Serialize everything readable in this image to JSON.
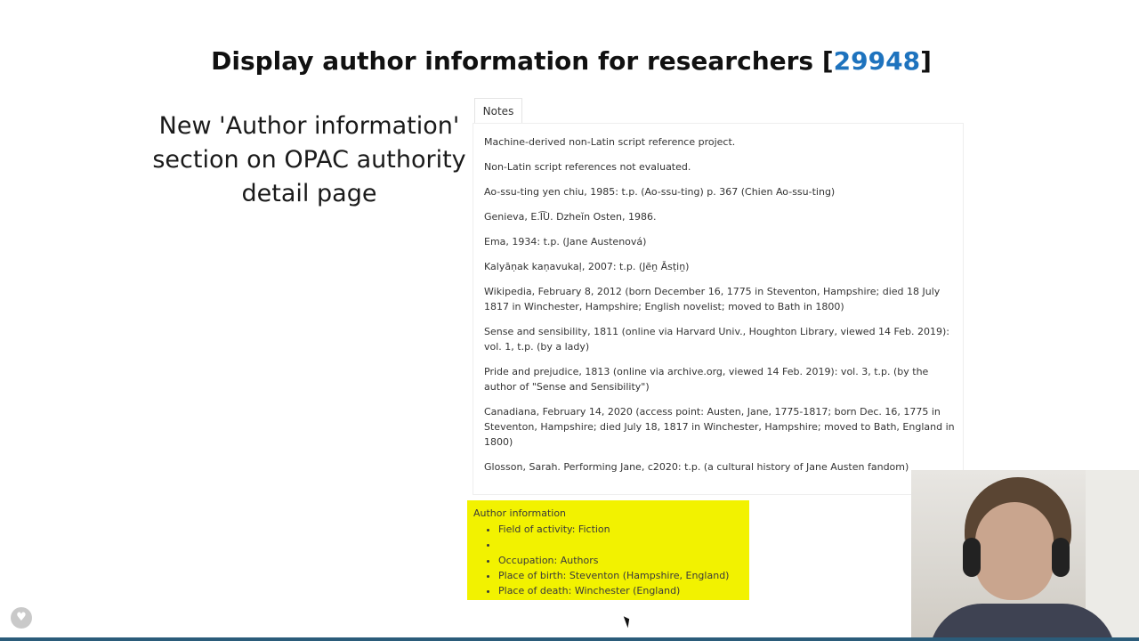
{
  "slide": {
    "title_prefix": "Display author information for researchers [",
    "bug_number": "29948",
    "title_suffix": "]",
    "caption": "New 'Author information' section on OPAC authority detail page"
  },
  "notes": {
    "tab_label": "Notes",
    "items": [
      "Machine-derived non-Latin script reference project.",
      "Non-Latin script references not evaluated.",
      "Ao-ssu-ting yen chiu, 1985: t.p. (Ao-ssu-ting) p. 367 (Chien Ao-ssu-ting)",
      "Genieva, E.I͡U. Dzheĭn Osten, 1986.",
      "Ema, 1934: t.p. (Jane Austenová)",
      "Kalyāṇak kaṇavukaḷ, 2007: t.p. (Jēṉ Āsṭiṉ)",
      "Wikipedia, February 8, 2012 (born December 16, 1775 in Steventon, Hampshire; died 18 July 1817 in Winchester, Hampshire; English novelist; moved to Bath in 1800)",
      "Sense and sensibility, 1811 (online via Harvard Univ., Houghton Library, viewed 14 Feb. 2019): vol. 1, t.p. (by a lady)",
      "Pride and prejudice, 1813 (online via archive.org, viewed 14 Feb. 2019): vol. 3, t.p. (by the author of \"Sense and Sensibility\")",
      "Canadiana, February 14, 2020 (access point: Austen, Jane, 1775-1817; born Dec. 16, 1775 in Steventon, Hampshire; died July 18, 1817 in Winchester, Hampshire; moved to Bath, England in 1800)",
      "Glosson, Sarah. Performing Jane, c2020: t.p. (a cultural history of Jane Austen fandom)"
    ]
  },
  "author_info": {
    "heading": "Author information",
    "items": [
      "Field of activity: Fiction",
      "",
      "Occupation: Authors",
      "Place of birth: Steventon (Hampshire, England)",
      "Place of death: Winchester (England)"
    ],
    "highlight_color": "#f2f200"
  },
  "icons": {
    "feedback": "heart-icon",
    "cursor": "mouse-cursor-icon"
  }
}
